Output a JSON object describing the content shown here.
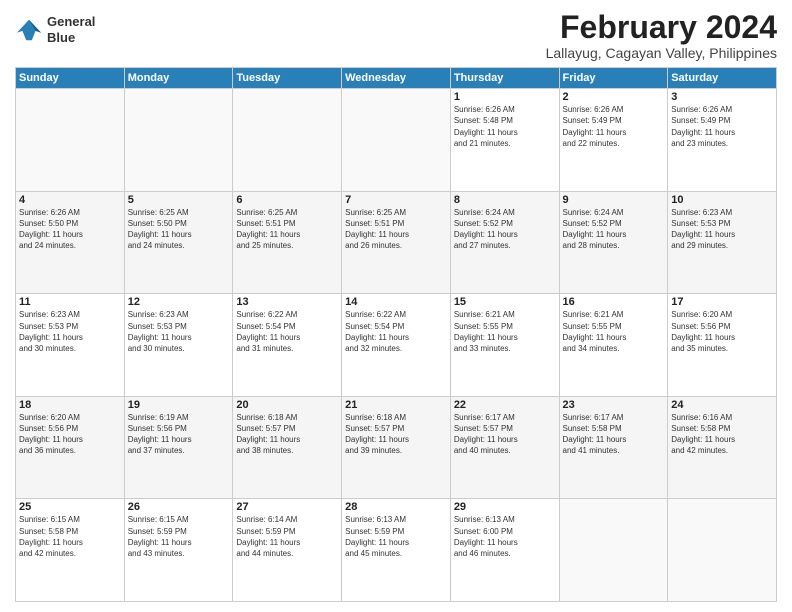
{
  "header": {
    "logo": {
      "line1": "General",
      "line2": "Blue"
    },
    "title": "February 2024",
    "subtitle": "Lallayug, Cagayan Valley, Philippines"
  },
  "weekdays": [
    "Sunday",
    "Monday",
    "Tuesday",
    "Wednesday",
    "Thursday",
    "Friday",
    "Saturday"
  ],
  "weeks": [
    [
      {
        "day": "",
        "info": ""
      },
      {
        "day": "",
        "info": ""
      },
      {
        "day": "",
        "info": ""
      },
      {
        "day": "",
        "info": ""
      },
      {
        "day": "1",
        "info": "Sunrise: 6:26 AM\nSunset: 5:48 PM\nDaylight: 11 hours\nand 21 minutes."
      },
      {
        "day": "2",
        "info": "Sunrise: 6:26 AM\nSunset: 5:49 PM\nDaylight: 11 hours\nand 22 minutes."
      },
      {
        "day": "3",
        "info": "Sunrise: 6:26 AM\nSunset: 5:49 PM\nDaylight: 11 hours\nand 23 minutes."
      }
    ],
    [
      {
        "day": "4",
        "info": "Sunrise: 6:26 AM\nSunset: 5:50 PM\nDaylight: 11 hours\nand 24 minutes."
      },
      {
        "day": "5",
        "info": "Sunrise: 6:25 AM\nSunset: 5:50 PM\nDaylight: 11 hours\nand 24 minutes."
      },
      {
        "day": "6",
        "info": "Sunrise: 6:25 AM\nSunset: 5:51 PM\nDaylight: 11 hours\nand 25 minutes."
      },
      {
        "day": "7",
        "info": "Sunrise: 6:25 AM\nSunset: 5:51 PM\nDaylight: 11 hours\nand 26 minutes."
      },
      {
        "day": "8",
        "info": "Sunrise: 6:24 AM\nSunset: 5:52 PM\nDaylight: 11 hours\nand 27 minutes."
      },
      {
        "day": "9",
        "info": "Sunrise: 6:24 AM\nSunset: 5:52 PM\nDaylight: 11 hours\nand 28 minutes."
      },
      {
        "day": "10",
        "info": "Sunrise: 6:23 AM\nSunset: 5:53 PM\nDaylight: 11 hours\nand 29 minutes."
      }
    ],
    [
      {
        "day": "11",
        "info": "Sunrise: 6:23 AM\nSunset: 5:53 PM\nDaylight: 11 hours\nand 30 minutes."
      },
      {
        "day": "12",
        "info": "Sunrise: 6:23 AM\nSunset: 5:53 PM\nDaylight: 11 hours\nand 30 minutes."
      },
      {
        "day": "13",
        "info": "Sunrise: 6:22 AM\nSunset: 5:54 PM\nDaylight: 11 hours\nand 31 minutes."
      },
      {
        "day": "14",
        "info": "Sunrise: 6:22 AM\nSunset: 5:54 PM\nDaylight: 11 hours\nand 32 minutes."
      },
      {
        "day": "15",
        "info": "Sunrise: 6:21 AM\nSunset: 5:55 PM\nDaylight: 11 hours\nand 33 minutes."
      },
      {
        "day": "16",
        "info": "Sunrise: 6:21 AM\nSunset: 5:55 PM\nDaylight: 11 hours\nand 34 minutes."
      },
      {
        "day": "17",
        "info": "Sunrise: 6:20 AM\nSunset: 5:56 PM\nDaylight: 11 hours\nand 35 minutes."
      }
    ],
    [
      {
        "day": "18",
        "info": "Sunrise: 6:20 AM\nSunset: 5:56 PM\nDaylight: 11 hours\nand 36 minutes."
      },
      {
        "day": "19",
        "info": "Sunrise: 6:19 AM\nSunset: 5:56 PM\nDaylight: 11 hours\nand 37 minutes."
      },
      {
        "day": "20",
        "info": "Sunrise: 6:18 AM\nSunset: 5:57 PM\nDaylight: 11 hours\nand 38 minutes."
      },
      {
        "day": "21",
        "info": "Sunrise: 6:18 AM\nSunset: 5:57 PM\nDaylight: 11 hours\nand 39 minutes."
      },
      {
        "day": "22",
        "info": "Sunrise: 6:17 AM\nSunset: 5:57 PM\nDaylight: 11 hours\nand 40 minutes."
      },
      {
        "day": "23",
        "info": "Sunrise: 6:17 AM\nSunset: 5:58 PM\nDaylight: 11 hours\nand 41 minutes."
      },
      {
        "day": "24",
        "info": "Sunrise: 6:16 AM\nSunset: 5:58 PM\nDaylight: 11 hours\nand 42 minutes."
      }
    ],
    [
      {
        "day": "25",
        "info": "Sunrise: 6:15 AM\nSunset: 5:58 PM\nDaylight: 11 hours\nand 42 minutes."
      },
      {
        "day": "26",
        "info": "Sunrise: 6:15 AM\nSunset: 5:59 PM\nDaylight: 11 hours\nand 43 minutes."
      },
      {
        "day": "27",
        "info": "Sunrise: 6:14 AM\nSunset: 5:59 PM\nDaylight: 11 hours\nand 44 minutes."
      },
      {
        "day": "28",
        "info": "Sunrise: 6:13 AM\nSunset: 5:59 PM\nDaylight: 11 hours\nand 45 minutes."
      },
      {
        "day": "29",
        "info": "Sunrise: 6:13 AM\nSunset: 6:00 PM\nDaylight: 11 hours\nand 46 minutes."
      },
      {
        "day": "",
        "info": ""
      },
      {
        "day": "",
        "info": ""
      }
    ]
  ]
}
